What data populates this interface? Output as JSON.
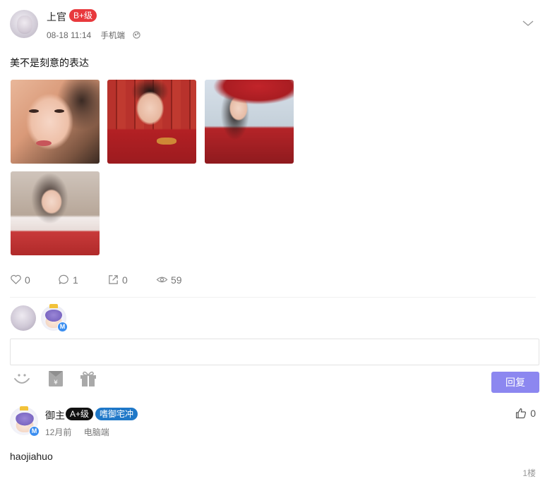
{
  "post": {
    "author": "上官",
    "level_badge": "B+级",
    "time": "08-18 11:14",
    "device": "手机端",
    "content": "美不是刻意的表达",
    "photo_count": 4,
    "stats": {
      "likes": "0",
      "comments": "1",
      "shares": "0",
      "views": "59"
    }
  },
  "comment_box": {
    "placeholder": "",
    "reply_label": "回复"
  },
  "comments": [
    {
      "author": "御主",
      "level_badge": "A+级",
      "tag": "嗜御宅冲",
      "time": "12月前",
      "device": "电脑端",
      "likes": "0",
      "text": "haojiahuo",
      "floor": "1楼"
    }
  ],
  "colors": {
    "level_b_plus": "#e8393d",
    "level_a_plus": "#111111",
    "tag_blue": "#1f78c8",
    "reply_button": "#8c87f0",
    "vip_badge": "#3b8ef0"
  },
  "icons": [
    "chevron-down-icon",
    "globe-icon",
    "heart-icon",
    "comment-icon",
    "share-icon",
    "eye-icon",
    "emoji-icon",
    "red-packet-icon",
    "gift-icon",
    "thumbs-up-icon"
  ]
}
